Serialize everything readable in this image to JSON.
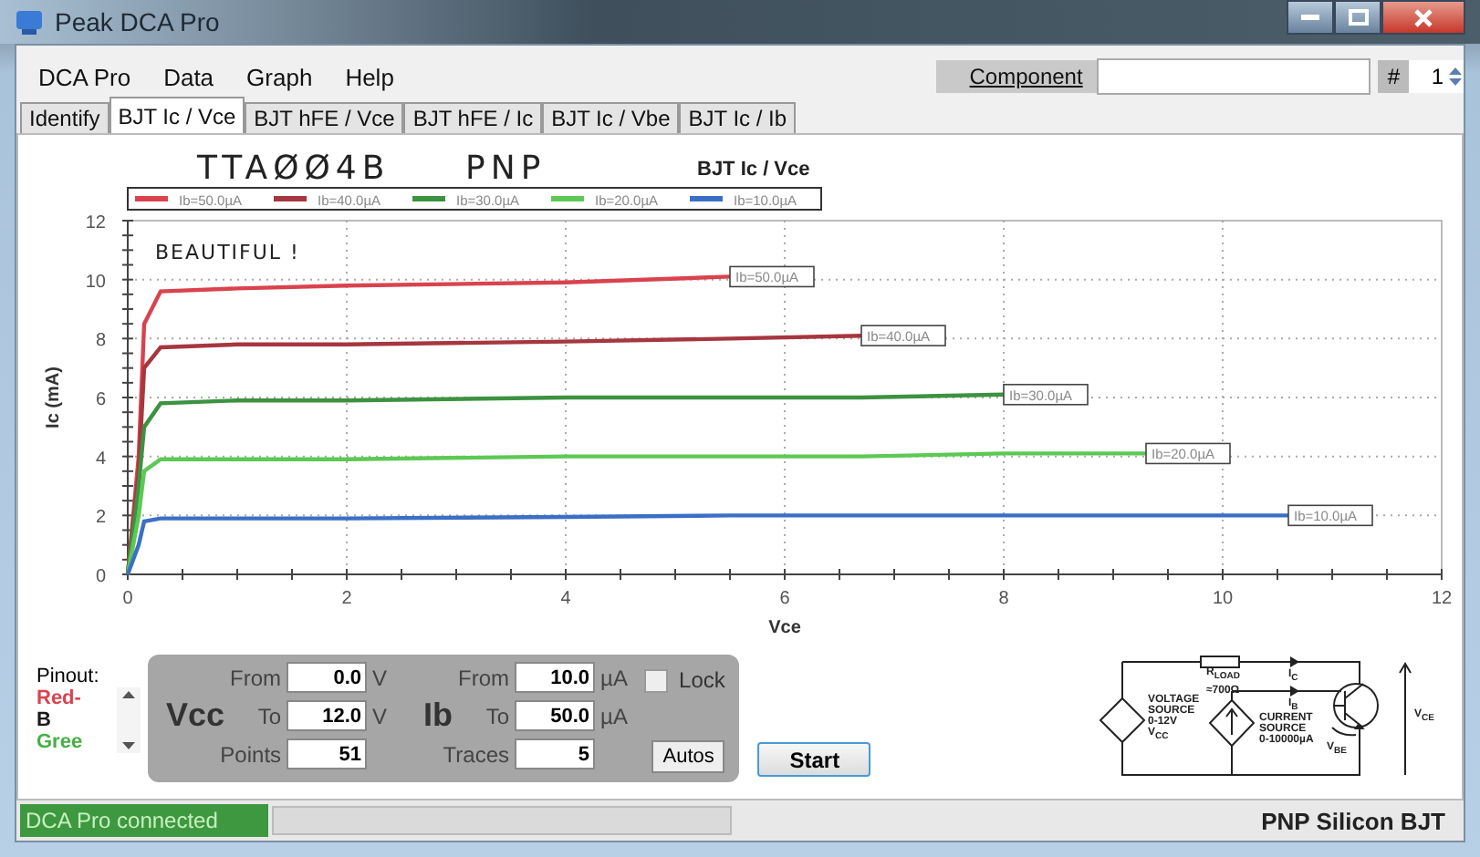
{
  "window": {
    "title": "Peak DCA Pro"
  },
  "menu": [
    "DCA Pro",
    "Data",
    "Graph",
    "Help"
  ],
  "component": {
    "label": "Component",
    "number_label": "#",
    "number": "1"
  },
  "tabs": [
    {
      "label": "Identify",
      "selected": false
    },
    {
      "label": "BJT Ic / Vce",
      "selected": true
    },
    {
      "label": "BJT hFE / Vce",
      "selected": false
    },
    {
      "label": "BJT hFE / Ic",
      "selected": false
    },
    {
      "label": "BJT Ic / Vbe",
      "selected": false
    },
    {
      "label": "BJT Ic / Ib",
      "selected": false
    }
  ],
  "handwritten_notes": [
    "TTAØØ4B",
    "PNP",
    "BEAUTIFUL !"
  ],
  "chart_data": {
    "type": "line",
    "title": "BJT Ic / Vce",
    "xlabel": "Vce",
    "ylabel": "Ic (mA)",
    "x": [
      0,
      0.1,
      0.15,
      0.3,
      1,
      2,
      4,
      5.5,
      6.7,
      8,
      9.3,
      10.6
    ],
    "series": [
      {
        "name": "Ib=50.0µA",
        "color": "#d9434e",
        "values": [
          0,
          4,
          8.5,
          9.6,
          9.7,
          9.8,
          9.9,
          10.1,
          null,
          null,
          null,
          null
        ]
      },
      {
        "name": "Ib=40.0µA",
        "color": "#a6363f",
        "values": [
          0,
          3.5,
          7,
          7.7,
          7.8,
          7.8,
          7.9,
          8,
          8.1,
          null,
          null,
          null
        ]
      },
      {
        "name": "Ib=30.0µA",
        "color": "#3c9240",
        "values": [
          0,
          3,
          5,
          5.8,
          5.9,
          5.9,
          6,
          6,
          6,
          6.1,
          null,
          null
        ]
      },
      {
        "name": "Ib=20.0µA",
        "color": "#5cc954",
        "values": [
          0,
          2,
          3.5,
          3.9,
          3.9,
          3.9,
          4,
          4,
          4,
          4.1,
          4.1,
          null
        ]
      },
      {
        "name": "Ib=10.0µA",
        "color": "#3b6fc6",
        "values": [
          0,
          1,
          1.8,
          1.9,
          1.9,
          1.9,
          1.95,
          2,
          2,
          2,
          2,
          2
        ]
      }
    ],
    "xlim": [
      0,
      12
    ],
    "ylim": [
      0,
      12
    ],
    "xticks": [
      0,
      2,
      4,
      6,
      8,
      10,
      12
    ],
    "yticks": [
      0,
      2,
      4,
      6,
      8,
      10,
      12
    ],
    "grid": true,
    "legend": "top"
  },
  "pinout": {
    "label": "Pinout:",
    "items": [
      {
        "text": "Red-",
        "color": "#d9434e"
      },
      {
        "text": "B",
        "color": "#1a1a1a"
      },
      {
        "text": "Gree",
        "color": "#44b044"
      }
    ]
  },
  "vcc": {
    "label": "Vcc",
    "from_label": "From",
    "from": "0.0",
    "from_unit": "V",
    "to_label": "To",
    "to": "12.0",
    "to_unit": "V",
    "points_label": "Points",
    "points": "51"
  },
  "ib": {
    "label": "Ib",
    "from_label": "From",
    "from": "10.0",
    "from_unit": "µA",
    "to_label": "To",
    "to": "50.0",
    "to_unit": "µA",
    "traces_label": "Traces",
    "traces": "5"
  },
  "lock": {
    "label": "Lock",
    "checked": false
  },
  "buttons": {
    "autos": "Autos",
    "start": "Start"
  },
  "circuit": {
    "rload": "R$_{LOAD}$",
    "rload_value": "≈700Ω",
    "ic": "I$_{C}$",
    "ib": "I$_{B}$",
    "voltage_source": [
      "VOLTAGE",
      "SOURCE",
      "0-12V",
      "V$_{CC}$"
    ],
    "current_source": [
      "CURRENT",
      "SOURCE",
      "0-10000µA"
    ],
    "vbe": "V$_{BE}$",
    "vce": "V$_{CE}$"
  },
  "status_bar": {
    "connection": "DCA Pro connected",
    "device": "PNP Silicon BJT"
  }
}
